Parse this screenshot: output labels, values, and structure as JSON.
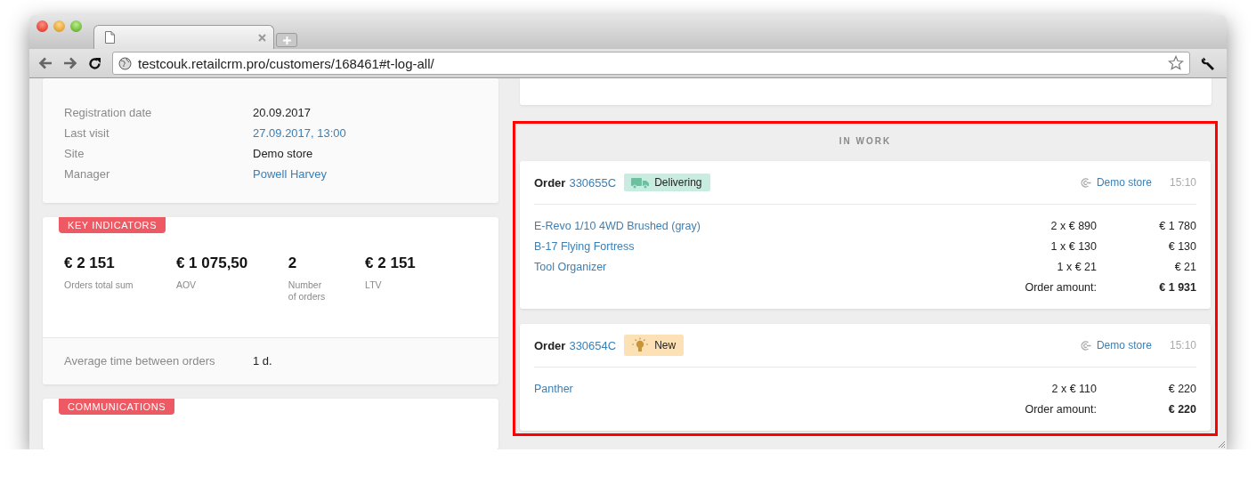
{
  "browser": {
    "url": "testcouk.retailcrm.pro/customers/168461#t-log-all/"
  },
  "customer_info": [
    {
      "label": "Registration date",
      "value": "20.09.2017",
      "link": false
    },
    {
      "label": "Last visit",
      "value": "27.09.2017, 13:00",
      "link": true
    },
    {
      "label": "Site",
      "value": "Demo store",
      "link": false
    },
    {
      "label": "Manager",
      "value": "Powell Harvey",
      "link": true
    }
  ],
  "key_indicators": {
    "title": "KEY INDICATORS",
    "metrics": [
      {
        "value": "€ 2 151",
        "label": "Orders total sum"
      },
      {
        "value": "€ 1 075,50",
        "label": "AOV"
      },
      {
        "value": "2",
        "label": "Number of orders"
      },
      {
        "value": "€ 2 151",
        "label": "LTV"
      }
    ],
    "average": {
      "label": "Average time between orders",
      "value": "1 d."
    }
  },
  "communications": {
    "title": "COMMUNICATIONS"
  },
  "in_work": {
    "title": "IN WORK",
    "orders": [
      {
        "label": "Order",
        "number": "330655C",
        "status": {
          "kind": "delivering",
          "label": "Delivering"
        },
        "site": "Demo store",
        "time": "15:10",
        "items": [
          {
            "name": "E-Revo 1/10 4WD Brushed (gray)",
            "qty_price": "2 x € 890",
            "total": "€ 1 780"
          },
          {
            "name": "B-17 Flying Fortress",
            "qty_price": "1 x € 130",
            "total": "€ 130"
          },
          {
            "name": "Tool Organizer",
            "qty_price": "1 x € 21",
            "total": "€ 21"
          }
        ],
        "amount_label": "Order amount:",
        "amount": "€ 1 931"
      },
      {
        "label": "Order",
        "number": "330654C",
        "status": {
          "kind": "new",
          "label": "New"
        },
        "site": "Demo store",
        "time": "15:10",
        "items": [
          {
            "name": "Panther",
            "qty_price": "2 x € 110",
            "total": "€ 220"
          }
        ],
        "amount_label": "Order amount:",
        "amount": "€ 220"
      }
    ]
  }
}
